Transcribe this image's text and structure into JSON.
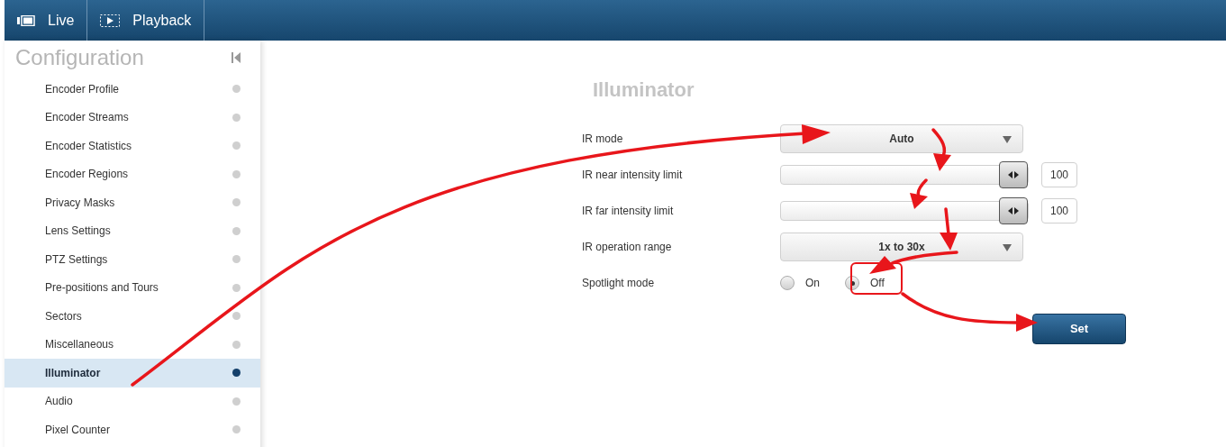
{
  "top_tabs": [
    {
      "label": "Live"
    },
    {
      "label": "Playback"
    }
  ],
  "sidebar": {
    "title": "Configuration",
    "items": [
      {
        "label": "Encoder Profile",
        "selected": false
      },
      {
        "label": "Encoder Streams",
        "selected": false
      },
      {
        "label": "Encoder Statistics",
        "selected": false
      },
      {
        "label": "Encoder Regions",
        "selected": false
      },
      {
        "label": "Privacy Masks",
        "selected": false
      },
      {
        "label": "Lens Settings",
        "selected": false
      },
      {
        "label": "PTZ Settings",
        "selected": false
      },
      {
        "label": "Pre-positions and Tours",
        "selected": false
      },
      {
        "label": "Sectors",
        "selected": false
      },
      {
        "label": "Miscellaneous",
        "selected": false
      },
      {
        "label": "Illuminator",
        "selected": true
      },
      {
        "label": "Audio",
        "selected": false
      },
      {
        "label": "Pixel Counter",
        "selected": false
      }
    ]
  },
  "form": {
    "title": "Illuminator",
    "rows": [
      {
        "kind": "select",
        "label": "IR mode",
        "value": "Auto"
      },
      {
        "kind": "slider",
        "label": "IR near intensity limit",
        "level": 1.0,
        "value": "100"
      },
      {
        "kind": "slider",
        "label": "IR far intensity limit",
        "level": 1.0,
        "value": "100"
      },
      {
        "kind": "select",
        "label": "IR operation range",
        "value": "1x to 30x"
      },
      {
        "kind": "radio",
        "label": "Spotlight mode",
        "options": [
          {
            "label": "On",
            "selected": false
          },
          {
            "label": "Off",
            "selected": true
          }
        ]
      }
    ],
    "button": "Set"
  }
}
